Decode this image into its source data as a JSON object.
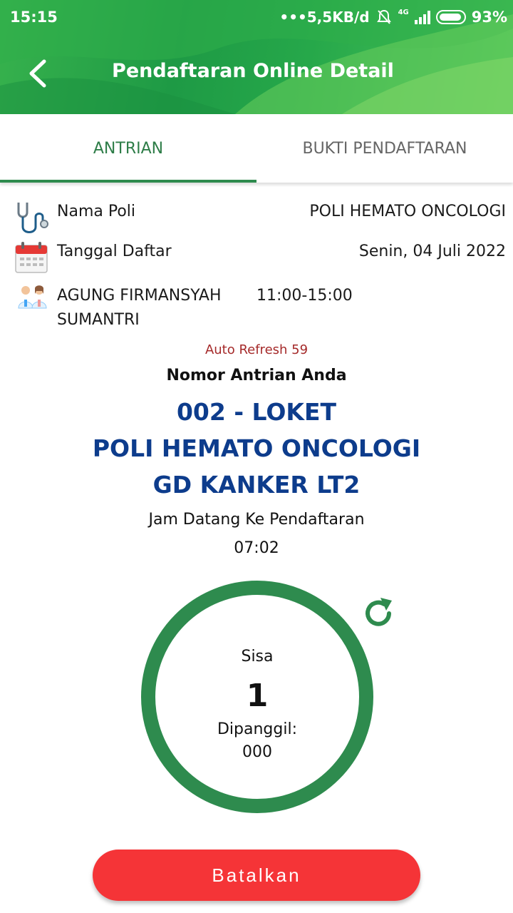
{
  "status_bar": {
    "time": "15:15",
    "network_speed": "5,5KB/d",
    "network_type": "4G",
    "battery": "93%"
  },
  "header": {
    "title": "Pendaftaran Online Detail",
    "back_icon": "chevron-left-icon"
  },
  "tabs": [
    {
      "label": "ANTRIAN",
      "active": true
    },
    {
      "label": "BUKTI PENDAFTARAN",
      "active": false
    }
  ],
  "info": {
    "poli_label": "Nama Poli",
    "poli_value": "POLI HEMATO ONCOLOGI",
    "tanggal_label": "Tanggal Daftar",
    "tanggal_value": "Senin, 04 Juli 2022",
    "doctor_name_line1": "AGUNG FIRMANSYAH",
    "doctor_name_line2": "SUMANTRI",
    "doctor_hours": "11:00-15:00"
  },
  "queue": {
    "auto_refresh": "Auto Refresh 59",
    "nomor_label": "Nomor Antrian Anda",
    "line1": "002 - LOKET",
    "line2": "POLI HEMATO ONCOLOGI",
    "line3": "GD KANKER LT2",
    "jam_label": "Jam Datang Ke Pendaftaran",
    "jam_value": "07:02",
    "sisa_label": "Sisa",
    "sisa_value": "1",
    "dipanggil_label": "Dipanggil:",
    "dipanggil_value": "000"
  },
  "actions": {
    "cancel_label": "Batalkan"
  },
  "colors": {
    "primary_green": "#2e8b4e",
    "queue_blue": "#0d3c8c",
    "refresh_red": "#a52a2a",
    "cancel_red": "#f53437"
  }
}
